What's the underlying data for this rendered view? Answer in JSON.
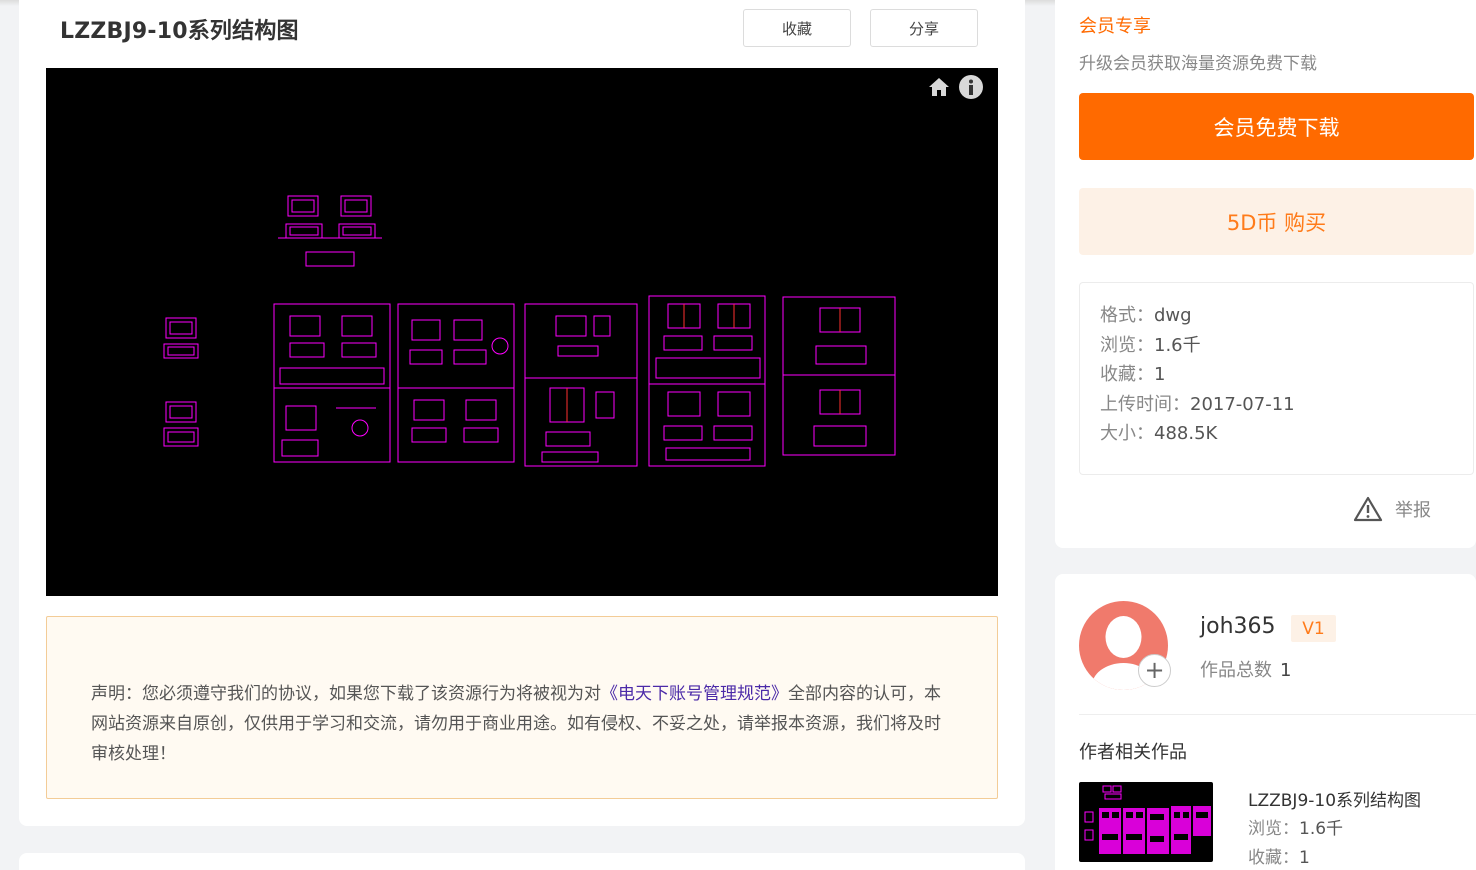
{
  "page": {
    "title": "LZZBJ9-10系列结构图"
  },
  "actions": {
    "favorite_label": "收藏",
    "share_label": "分享"
  },
  "notice": {
    "prefix": "声明：您必须遵守我们的协议，如果您下载了该资源行为将被视为对",
    "link_text": "《电天下账号管理规范》",
    "suffix": "全部内容的认可，本网站资源来自原创，仅供用于学习和交流，请勿用于商业用途。如有侵权、不妥之处，请举报本资源，我们将及时审核处理！"
  },
  "vip": {
    "title": "会员专享",
    "subtitle": "升级会员获取海量资源免费下载",
    "download_label": "会员免费下载",
    "buy_label": "5D币 购买"
  },
  "file_info": {
    "format_label": "格式：",
    "format": "dwg",
    "views_label": "浏览：",
    "views": "1.6千",
    "favorites_label": "收藏：",
    "favorites": "1",
    "upload_label": "上传时间：",
    "upload_time": "2017-07-11",
    "size_label": "大小：",
    "size": "488.5K"
  },
  "report": {
    "label": "举报"
  },
  "author": {
    "name": "joh365",
    "level": "V1",
    "works_label": "作品总数",
    "works_count": "1"
  },
  "related": {
    "title": "作者相关作品",
    "items": [
      {
        "name": "LZZBJ9-10系列结构图",
        "views_label": "浏览：",
        "views": "1.6千",
        "favs_label": "收藏：",
        "favs": "1"
      }
    ]
  },
  "colors": {
    "accent": "#ff6a00",
    "accent_light": "#fdf1e6",
    "cad_line": "#ff00ff",
    "viewer_bg": "#000000"
  },
  "icons": [
    "home-icon",
    "info-icon",
    "warning-icon",
    "plus-icon"
  ]
}
